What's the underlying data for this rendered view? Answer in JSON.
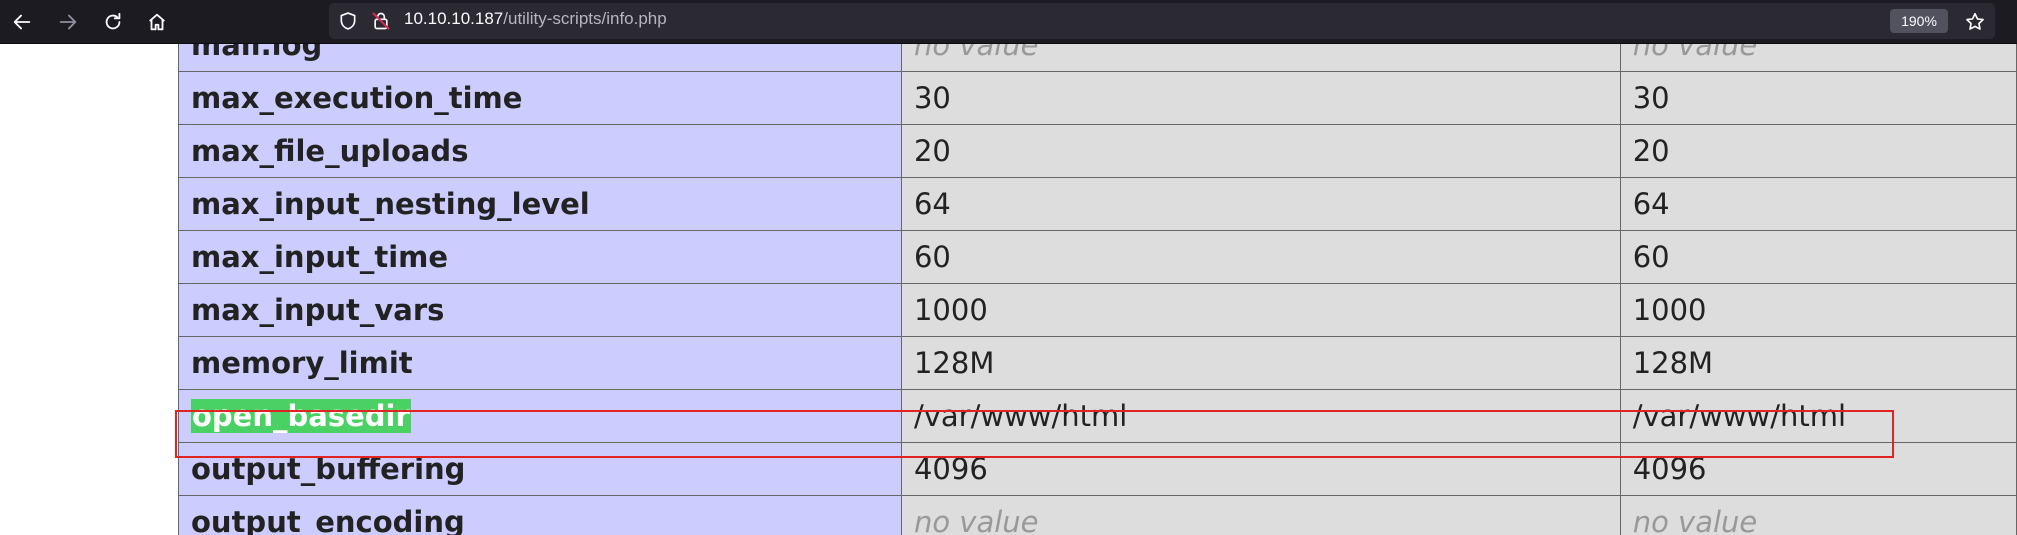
{
  "browser": {
    "url_host": "10.10.10.187",
    "url_path": "/utility-scripts/info.php",
    "zoom": "190%"
  },
  "colors": {
    "toolbar_bg": "#1c1b22",
    "urlbar_bg": "#2b2a33",
    "key_cell_bg": "#ccccff",
    "value_cell_bg": "#dddddd",
    "highlight": "#4ad163",
    "annotation_box": "#e02424"
  },
  "icons": [
    "back-arrow-icon",
    "forward-arrow-icon",
    "reload-icon",
    "home-icon",
    "shield-icon",
    "insecure-lock-icon",
    "bookmark-star-icon"
  ],
  "rows": [
    {
      "directive": "mail.log",
      "local": "no value",
      "master": "no value"
    },
    {
      "directive": "max_execution_time",
      "local": "30",
      "master": "30"
    },
    {
      "directive": "max_file_uploads",
      "local": "20",
      "master": "20"
    },
    {
      "directive": "max_input_nesting_level",
      "local": "64",
      "master": "64"
    },
    {
      "directive": "max_input_time",
      "local": "60",
      "master": "60"
    },
    {
      "directive": "max_input_vars",
      "local": "1000",
      "master": "1000"
    },
    {
      "directive": "memory_limit",
      "local": "128M",
      "master": "128M"
    },
    {
      "directive": "open_basedir",
      "local": "/var/www/html",
      "master": "/var/www/html"
    },
    {
      "directive": "output_buffering",
      "local": "4096",
      "master": "4096"
    },
    {
      "directive": "output_encoding",
      "local": "no value",
      "master": "no value"
    }
  ]
}
